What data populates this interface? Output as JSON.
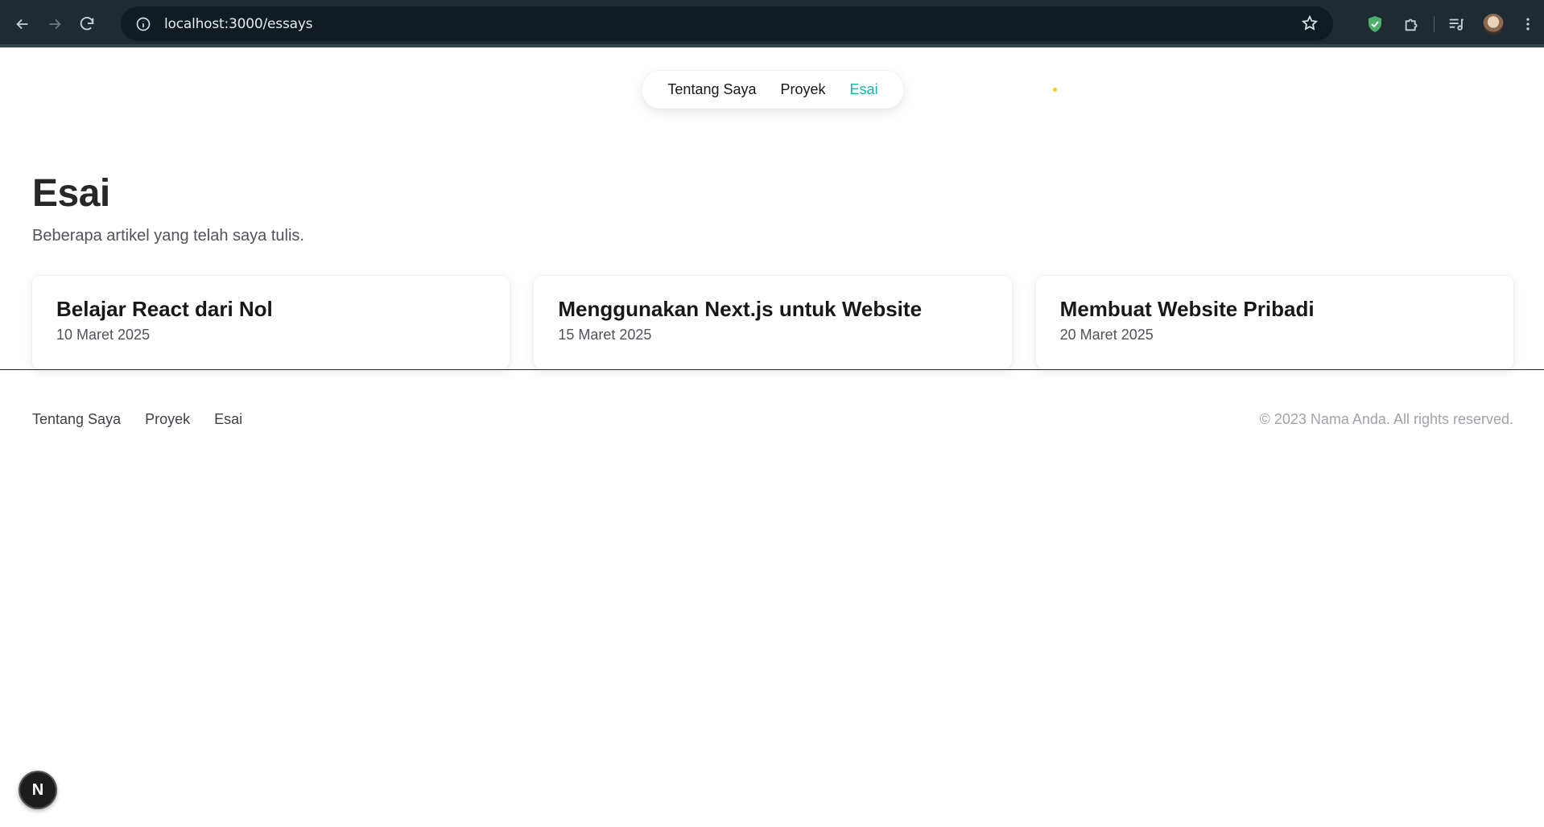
{
  "browser": {
    "url": "localhost:3000/essays"
  },
  "nav": {
    "items": [
      {
        "label": "Tentang Saya",
        "active": false
      },
      {
        "label": "Proyek",
        "active": false
      },
      {
        "label": "Esai",
        "active": true
      }
    ],
    "active_color": "#14b8a6"
  },
  "main": {
    "title": "Esai",
    "subtitle": "Beberapa artikel yang telah saya tulis.",
    "essays": [
      {
        "title": "Belajar React dari Nol",
        "date": "10 Maret 2025"
      },
      {
        "title": "Menggunakan Next.js untuk Website",
        "date": "15 Maret 2025"
      },
      {
        "title": "Membuat Website Pribadi",
        "date": "20 Maret 2025"
      }
    ]
  },
  "footer": {
    "links": [
      "Tentang Saya",
      "Proyek",
      "Esai"
    ],
    "copyright": "© 2023 Nama Anda. All rights reserved."
  },
  "dev_badge": {
    "label": "N"
  }
}
